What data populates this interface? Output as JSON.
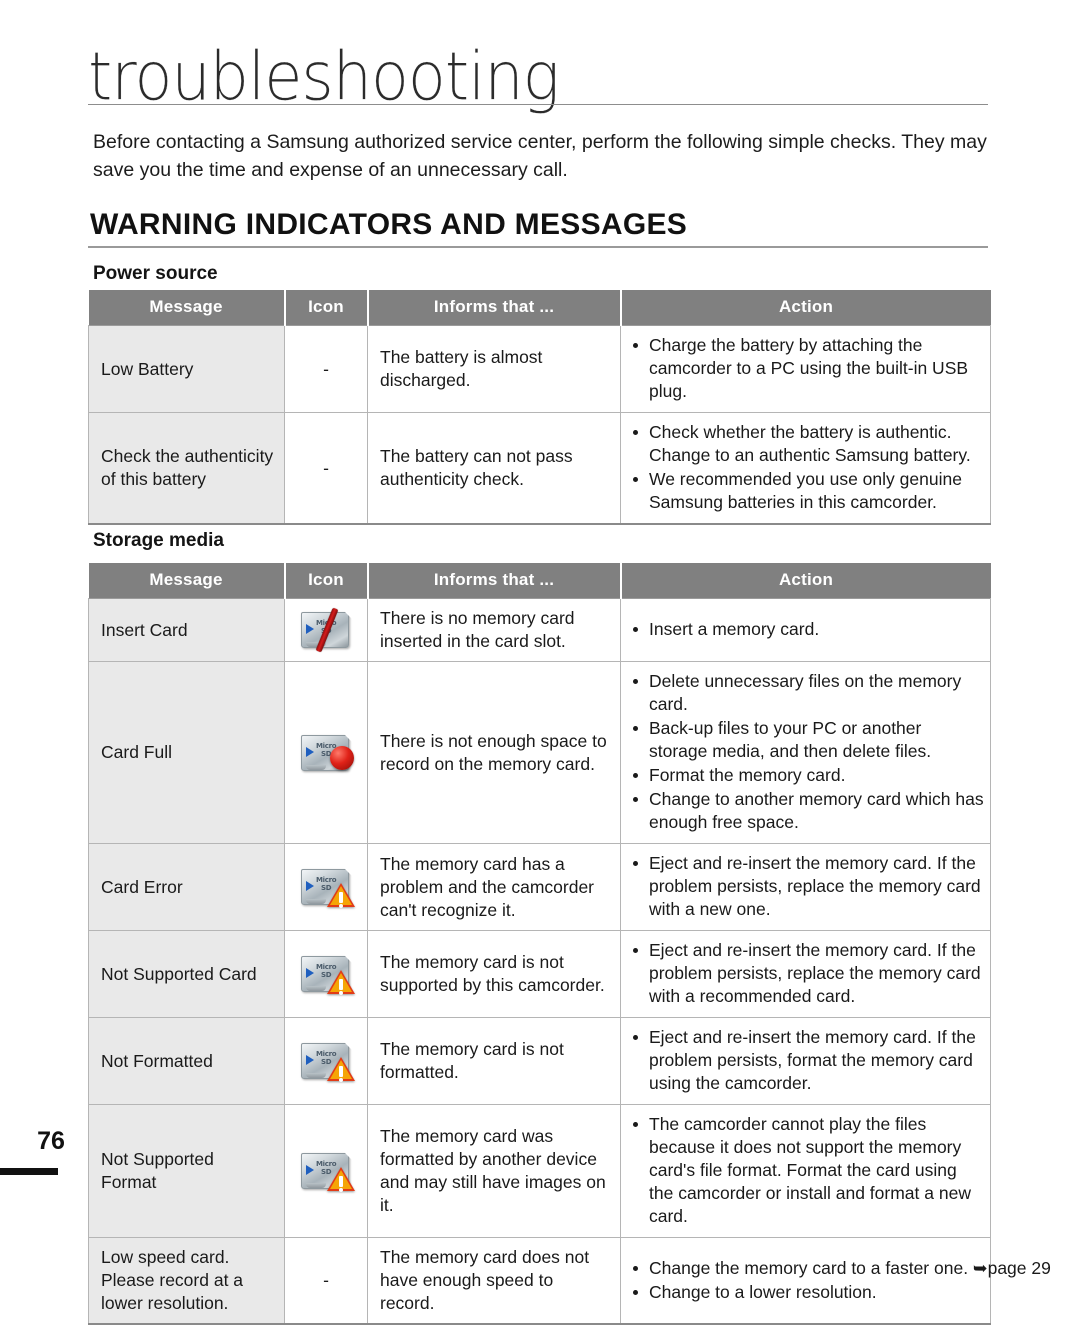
{
  "page": {
    "title": "troubleshooting",
    "number": "76",
    "intro": "Before contacting a Samsung authorized service center, perform the following simple checks. They may save you the time and expense of an unnecessary call.",
    "section_heading": "WARNING INDICATORS AND MESSAGES"
  },
  "columns": {
    "message": "Message",
    "icon": "Icon",
    "informs": "Informs that ...",
    "action": "Action"
  },
  "power_source": {
    "sub_heading": "Power source",
    "rows": [
      {
        "message": "Low Battery",
        "icon": "-",
        "icon_type": "dash",
        "informs": "The battery is almost discharged.",
        "actions": [
          "Charge the battery by attaching the camcorder to a PC using the built-in USB plug."
        ]
      },
      {
        "message": "Check the authenticity of this battery",
        "icon": "-",
        "icon_type": "dash",
        "informs": "The battery can not pass authenticity check.",
        "actions": [
          "Check whether the battery is authentic. Change to an authentic Samsung battery.",
          "We recommended you use only genuine Samsung batteries in this camcorder."
        ]
      }
    ]
  },
  "storage_media": {
    "sub_heading": "Storage media",
    "rows": [
      {
        "message": "Insert Card",
        "icon_type": "sd-card-slash-icon",
        "icon_label": "Micro SD",
        "informs": "There is no memory card inserted in the card slot.",
        "actions": [
          "Insert a memory card."
        ]
      },
      {
        "message": "Card Full",
        "icon_type": "sd-card-full-icon",
        "icon_label": "Micro SD",
        "informs": "There is not enough space to record on the memory card.",
        "actions": [
          "Delete unnecessary files on the memory card.",
          "Back-up files to your PC or another storage media, and then delete files.",
          "Format the memory card.",
          "Change to another memory card which has enough free space."
        ]
      },
      {
        "message": "Card Error",
        "icon_type": "sd-card-warning-icon",
        "icon_label": "Micro SD",
        "informs": "The memory card has a problem and the camcorder can't recognize it.",
        "actions": [
          "Eject and re-insert the memory card. If the problem persists, replace the memory card with a new one."
        ]
      },
      {
        "message": "Not Supported Card",
        "icon_type": "sd-card-warning-icon",
        "icon_label": "Micro SD",
        "informs": "The memory card is not supported by this camcorder.",
        "actions": [
          "Eject and re-insert the memory card. If the problem persists, replace the memory card with a recommended card."
        ]
      },
      {
        "message": "Not Formatted",
        "icon_type": "sd-card-warning-icon",
        "icon_label": "Micro SD",
        "informs": "The memory card is not formatted.",
        "actions": [
          "Eject and re-insert the memory card. If the problem persists, format the memory card using the camcorder."
        ]
      },
      {
        "message": "Not Supported Format",
        "icon_type": "sd-card-warning-icon",
        "icon_label": "Micro SD",
        "informs": "The memory card was formatted by another device and may still have images on it.",
        "actions": [
          "The camcorder cannot play the files because it does not support the memory card's file format. Format the card using the camcorder or install and format a new card."
        ]
      },
      {
        "message": "Low speed card. Please record at a lower resolution.",
        "icon": "-",
        "icon_type": "dash",
        "informs": "The memory card does not have enough speed to record.",
        "actions": [
          "Change the memory card to a faster one. ➥page 29",
          "Change to a lower resolution."
        ]
      }
    ]
  },
  "colors": {
    "header_gray": "#808080",
    "message_cell_gray": "#e9e9e9",
    "border_gray": "#b5b5b5",
    "warn_red": "#e23b16",
    "warn_amber": "#f5a505",
    "slash_red": "#d61b1b"
  }
}
